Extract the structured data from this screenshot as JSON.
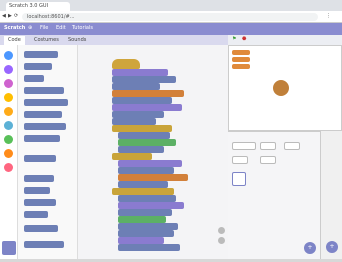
{
  "browser": {
    "tab_title": "Scratch 3.0 GUI",
    "url": "localhost:8601/#..."
  },
  "menubar": {
    "logo": "Scratch",
    "items": [
      "File",
      "Edit",
      "Tutorials"
    ]
  },
  "editor": {
    "tabs": [
      "Code",
      "Costumes",
      "Sounds"
    ]
  },
  "colors": {
    "menubar": "#8a8cd0",
    "motion": "#6d7fb5",
    "control": "#c9a43a",
    "looks": "#8a7bd0",
    "events": "#cfa53c",
    "operators": "#5cb065",
    "variables": "#d2803a"
  },
  "icons": [
    "globe-icon",
    "refresh-icon",
    "back-icon",
    "forward-icon",
    "green-flag-icon",
    "stop-icon",
    "zoom-in-icon",
    "zoom-out-icon",
    "add-sprite-icon",
    "add-backdrop-icon"
  ]
}
